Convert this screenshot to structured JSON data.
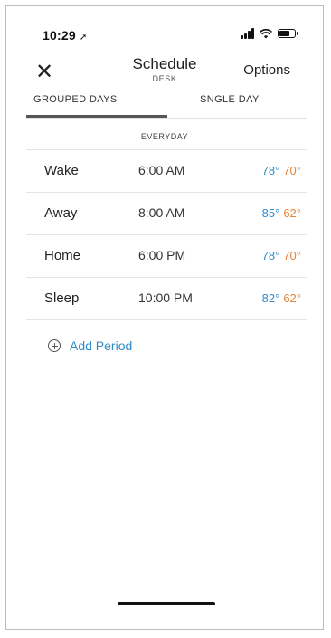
{
  "status_bar": {
    "time": "10:29",
    "location_icon": "location-arrow-icon",
    "icons": [
      "signal-icon",
      "wifi-icon",
      "battery-icon"
    ]
  },
  "header": {
    "close_icon": "close-icon",
    "title": "Schedule",
    "subtitle": "DESK",
    "options_label": "Options"
  },
  "tabs": [
    {
      "label": "GROUPED DAYS",
      "active": true
    },
    {
      "label": "SNGLE DAY",
      "active": false
    }
  ],
  "section_label": "EVERYDAY",
  "periods": [
    {
      "name": "Wake",
      "time": "6:00 AM",
      "cool": "78°",
      "heat": "70°"
    },
    {
      "name": "Away",
      "time": "8:00 AM",
      "cool": "85°",
      "heat": "62°"
    },
    {
      "name": "Home",
      "time": "6:00 PM",
      "cool": "78°",
      "heat": "70°"
    },
    {
      "name": "Sleep",
      "time": "10:00 PM",
      "cool": "82°",
      "heat": "62°"
    }
  ],
  "add_period": {
    "icon": "plus-circle-icon",
    "label": "Add Period"
  },
  "colors": {
    "cool": "#2e8bc9",
    "heat": "#e98436",
    "accent": "#2e8bc9"
  }
}
